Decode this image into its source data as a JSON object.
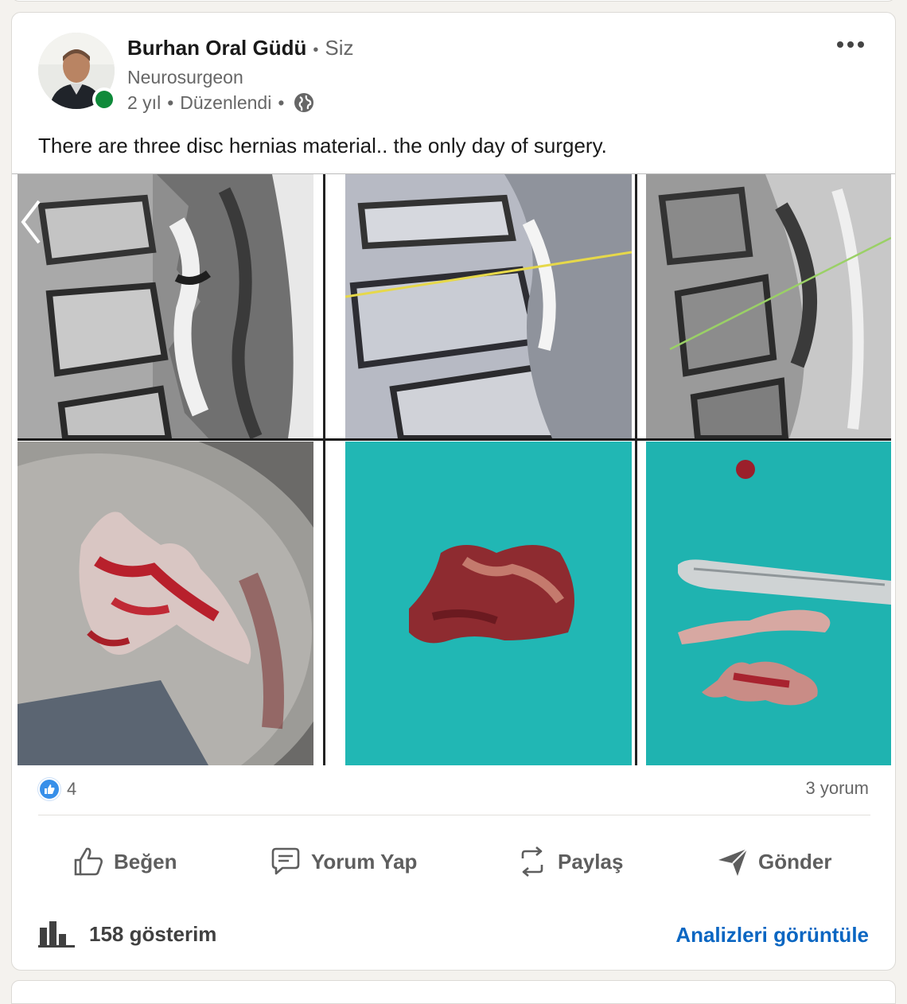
{
  "post": {
    "author_name": "Burhan Oral Güdü",
    "you_badge": "Siz",
    "headline": "Neurosurgeon",
    "age": "2 yıl",
    "edited": "Düzenlendi",
    "text": "There are three disc hernias material.. the only day of surgery."
  },
  "icons": {
    "avatar": "profile-photo",
    "presence": "online-status-dot",
    "visibility": "globe-icon",
    "more": "ellipsis-icon",
    "carousel_prev": "chevron-left-icon",
    "reaction": "thumbs-up-icon",
    "stats": "bar-chart-icon"
  },
  "social": {
    "reaction_count": "4",
    "comments": "3 yorum"
  },
  "actions": {
    "like": "Beğen",
    "comment": "Yorum Yap",
    "repost": "Paylaş",
    "send": "Gönder"
  },
  "footer": {
    "impressions": "158 gösterim",
    "analytics_link": "Analizleri görüntüle"
  },
  "colors": {
    "brand_blue": "#0a66c2",
    "presence_green": "#0f8a3a",
    "reaction_blue": "#378fe9",
    "drape_teal": "#1fb3b0"
  }
}
